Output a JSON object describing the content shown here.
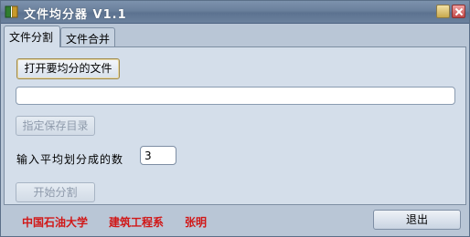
{
  "window": {
    "title": "文件均分器 V1.1",
    "icons": {
      "app": "book-icon",
      "minimize": "minimize-icon",
      "close": "close-icon"
    }
  },
  "tabs": [
    {
      "label": "文件分割",
      "active": true
    },
    {
      "label": "文件合并",
      "active": false
    }
  ],
  "split": {
    "open_button": "打开要均分的文件",
    "path_value": "",
    "save_dir_button": "指定保存目录",
    "count_label": "输入平均划分成的数",
    "count_value": "3",
    "start_button": "开始分割"
  },
  "footer": {
    "credit_school": "中国石油大学",
    "credit_dept": "建筑工程系",
    "credit_name": "张明",
    "exit_button": "退出"
  },
  "colors": {
    "credit_text": "#d11717",
    "window_bg": "#b9c6d6",
    "panel_bg": "#d4deea"
  }
}
